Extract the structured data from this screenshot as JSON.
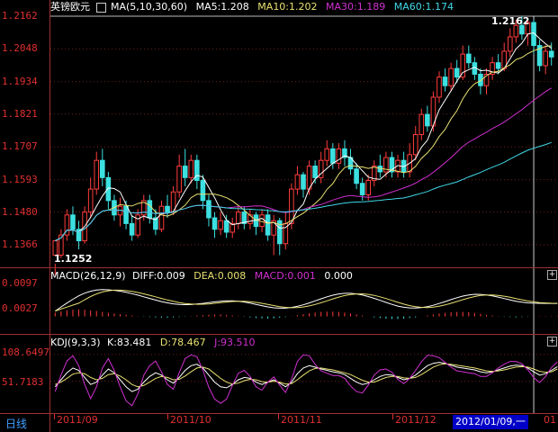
{
  "header": {
    "instrument": "英镑欧元",
    "indicator": "MA(5,10,30,60)",
    "ma5": "MA5:1.208",
    "ma10": "MA10:1.202",
    "ma30": "MA30:1.189",
    "ma60": "MA60:1.174"
  },
  "price_panel": {
    "y_ticks": [
      "1.2162",
      "1.2048",
      "1.1934",
      "1.1821",
      "1.1707",
      "1.1593",
      "1.1480",
      "1.1366"
    ],
    "high_label": "1.2162",
    "low_label": "1.1252"
  },
  "macd_panel": {
    "name": "MACD(26,12,9)",
    "diff": "DIFF:0.009",
    "dea": "DEA:0.008",
    "macd": "MACD:0.001",
    "extra": "0.000",
    "y_ticks": [
      "0.0097",
      "0.0027"
    ]
  },
  "kdj_panel": {
    "name": "KDJ(9,3,3)",
    "k": "K:83.481",
    "d": "D:78.467",
    "j": "J:93.510",
    "y_ticks": [
      "108.6497",
      "51.7183"
    ]
  },
  "footer": {
    "period": "日线",
    "dates": [
      "2011/09",
      "2011/10",
      "2011/11",
      "2011/12"
    ],
    "cursor_date": "2012/01/09,一",
    "next_date_stub": "01"
  },
  "colors": {
    "up": "#ff3c3c",
    "down": "#3ce0e0",
    "ma5": "#ffffff",
    "ma10": "#e8e070",
    "ma30": "#d030d0",
    "ma60": "#40d8e8",
    "axis": "#e03030",
    "cursor_bg": "#0000c8"
  },
  "chart_data": [
    {
      "type": "candlestick",
      "title": "英镑欧元",
      "ylim": [
        1.1252,
        1.2162
      ],
      "ohlc": [
        [
          1.133,
          1.138,
          1.13,
          1.126
        ],
        [
          1.133,
          1.14,
          1.142,
          1.132
        ],
        [
          1.14,
          1.147,
          1.149,
          1.138
        ],
        [
          1.147,
          1.142,
          1.15,
          1.14
        ],
        [
          1.142,
          1.138,
          1.145,
          1.135
        ],
        [
          1.138,
          1.148,
          1.15,
          1.137
        ],
        [
          1.148,
          1.156,
          1.16,
          1.146
        ],
        [
          1.156,
          1.166,
          1.169,
          1.154
        ],
        [
          1.166,
          1.16,
          1.17,
          1.157
        ],
        [
          1.16,
          1.152,
          1.162,
          1.149
        ],
        [
          1.152,
          1.147,
          1.154,
          1.145
        ],
        [
          1.147,
          1.15,
          1.153,
          1.143
        ],
        [
          1.15,
          1.144,
          1.152,
          1.142
        ],
        [
          1.144,
          1.14,
          1.147,
          1.138
        ],
        [
          1.14,
          1.147,
          1.149,
          1.139
        ],
        [
          1.147,
          1.152,
          1.154,
          1.145
        ],
        [
          1.152,
          1.146,
          1.154,
          1.144
        ],
        [
          1.146,
          1.142,
          1.149,
          1.14
        ],
        [
          1.142,
          1.15,
          1.152,
          1.141
        ],
        [
          1.15,
          1.148,
          1.154,
          1.146
        ],
        [
          1.148,
          1.155,
          1.157,
          1.147
        ],
        [
          1.155,
          1.164,
          1.168,
          1.153
        ],
        [
          1.164,
          1.16,
          1.17,
          1.157
        ],
        [
          1.16,
          1.166,
          1.168,
          1.158
        ],
        [
          1.166,
          1.159,
          1.168,
          1.156
        ],
        [
          1.159,
          1.152,
          1.161,
          1.149
        ],
        [
          1.152,
          1.146,
          1.154,
          1.143
        ],
        [
          1.146,
          1.142,
          1.148,
          1.139
        ],
        [
          1.142,
          1.145,
          1.148,
          1.14
        ],
        [
          1.145,
          1.141,
          1.147,
          1.139
        ],
        [
          1.141,
          1.144,
          1.146,
          1.139
        ],
        [
          1.144,
          1.148,
          1.15,
          1.142
        ],
        [
          1.148,
          1.144,
          1.15,
          1.142
        ],
        [
          1.144,
          1.147,
          1.149,
          1.142
        ],
        [
          1.147,
          1.143,
          1.148,
          1.14
        ],
        [
          1.143,
          1.147,
          1.149,
          1.141
        ],
        [
          1.147,
          1.14,
          1.149,
          1.138
        ],
        [
          1.14,
          1.145,
          1.147,
          1.133
        ],
        [
          1.145,
          1.137,
          1.146,
          1.133
        ],
        [
          1.137,
          1.144,
          1.148,
          1.135
        ],
        [
          1.144,
          1.156,
          1.158,
          1.142
        ],
        [
          1.156,
          1.161,
          1.164,
          1.154
        ],
        [
          1.161,
          1.156,
          1.162,
          1.153
        ],
        [
          1.156,
          1.164,
          1.166,
          1.154
        ],
        [
          1.164,
          1.16,
          1.166,
          1.158
        ],
        [
          1.16,
          1.166,
          1.169,
          1.158
        ],
        [
          1.166,
          1.17,
          1.173,
          1.164
        ],
        [
          1.17,
          1.165,
          1.172,
          1.163
        ],
        [
          1.165,
          1.17,
          1.172,
          1.163
        ],
        [
          1.17,
          1.167,
          1.173,
          1.164
        ],
        [
          1.167,
          1.163,
          1.17,
          1.161
        ],
        [
          1.163,
          1.158,
          1.165,
          1.156
        ],
        [
          1.158,
          1.154,
          1.16,
          1.152
        ],
        [
          1.154,
          1.159,
          1.161,
          1.152
        ],
        [
          1.159,
          1.164,
          1.166,
          1.157
        ],
        [
          1.164,
          1.162,
          1.168,
          1.16
        ],
        [
          1.162,
          1.167,
          1.169,
          1.16
        ],
        [
          1.167,
          1.162,
          1.169,
          1.16
        ],
        [
          1.162,
          1.166,
          1.168,
          1.16
        ],
        [
          1.166,
          1.162,
          1.169,
          1.16
        ],
        [
          1.162,
          1.168,
          1.172,
          1.16
        ],
        [
          1.168,
          1.175,
          1.178,
          1.166
        ],
        [
          1.175,
          1.182,
          1.184,
          1.173
        ],
        [
          1.182,
          1.178,
          1.185,
          1.176
        ],
        [
          1.178,
          1.188,
          1.19,
          1.176
        ],
        [
          1.188,
          1.195,
          1.197,
          1.186
        ],
        [
          1.195,
          1.192,
          1.198,
          1.19
        ],
        [
          1.192,
          1.198,
          1.2,
          1.19
        ],
        [
          1.198,
          1.195,
          1.201,
          1.193
        ],
        [
          1.195,
          1.203,
          1.206,
          1.194
        ],
        [
          1.203,
          1.2,
          1.206,
          1.198
        ],
        [
          1.2,
          1.196,
          1.202,
          1.194
        ],
        [
          1.196,
          1.192,
          1.198,
          1.189
        ],
        [
          1.192,
          1.196,
          1.198,
          1.189
        ],
        [
          1.196,
          1.2,
          1.202,
          1.194
        ],
        [
          1.2,
          1.198,
          1.203,
          1.196
        ],
        [
          1.198,
          1.204,
          1.207,
          1.197
        ],
        [
          1.204,
          1.209,
          1.212,
          1.202
        ],
        [
          1.209,
          1.213,
          1.215,
          1.207
        ],
        [
          1.213,
          1.21,
          1.2162,
          1.208
        ],
        [
          1.21,
          1.214,
          1.215,
          1.206
        ],
        [
          1.214,
          1.206,
          1.215,
          1.203
        ],
        [
          1.206,
          1.199,
          1.208,
          1.197
        ],
        [
          1.199,
          1.204,
          1.206,
          1.196
        ],
        [
          1.204,
          1.202,
          1.207,
          1.199
        ]
      ]
    },
    {
      "type": "bar",
      "title": "MACD(26,12,9)",
      "ylim": [
        -0.004,
        0.011
      ],
      "values": [
        0.0012,
        0.0016,
        0.0019,
        0.0021,
        0.0022,
        0.0021,
        0.0019,
        0.0017,
        0.0014,
        0.0011,
        0.0009,
        0.0007,
        0.0005,
        0.0003,
        0.0001,
        -0.0001,
        -0.0002,
        -0.0003,
        -0.0004,
        -0.0004,
        -0.0003,
        -0.0002,
        -0.0001,
        0.0001,
        0.0003,
        0.0004,
        0.0005,
        0.0006,
        0.0006,
        0.0005,
        0.0003,
        0.0001,
        -0.0001,
        -0.0003,
        -0.0005,
        -0.0006,
        -0.0007,
        -0.0006,
        -0.0004,
        -0.0002,
        0.0001,
        0.0004,
        0.0007,
        0.001,
        0.0012,
        0.0014,
        0.0015,
        0.0015,
        0.0014,
        0.0012,
        0.0009,
        0.0006,
        0.0003,
        0.0,
        -0.0003,
        -0.0005,
        -0.0007,
        -0.0008,
        -0.0008,
        -0.0007,
        -0.0005,
        -0.0003,
        0.0,
        0.0003,
        0.0006,
        0.0009,
        0.0011,
        0.0013,
        0.0014,
        0.0014,
        0.0013,
        0.0011,
        0.0008,
        0.0005,
        0.0003,
        0.0001,
        -0.0001,
        -0.0002,
        -0.0003,
        -0.0002,
        -0.0001,
        0.0,
        0.0001,
        0.0001,
        0.0001,
        0.0001
      ]
    },
    {
      "type": "line",
      "title": "KDJ(9,3,3)",
      "ylim": [
        -10,
        120
      ],
      "series": [
        {
          "name": "K",
          "values": [
            40,
            55,
            70,
            80,
            75,
            60,
            45,
            50,
            65,
            78,
            70,
            55,
            40,
            30,
            35,
            50,
            62,
            70,
            65,
            55,
            48,
            60,
            75,
            85,
            88,
            80,
            65,
            50,
            40,
            38,
            45,
            55,
            60,
            58,
            50,
            45,
            50,
            55,
            48,
            40,
            50,
            68,
            80,
            85,
            82,
            78,
            75,
            72,
            70,
            66,
            58,
            50,
            45,
            48,
            55,
            62,
            66,
            65,
            60,
            55,
            58,
            65,
            75,
            85,
            90,
            92,
            90,
            86,
            82,
            80,
            78,
            76,
            72,
            70,
            72,
            76,
            80,
            84,
            86,
            85,
            80,
            72,
            65,
            68,
            75,
            83
          ]
        },
        {
          "name": "D",
          "values": [
            45,
            50,
            58,
            67,
            70,
            68,
            60,
            55,
            58,
            66,
            68,
            63,
            55,
            45,
            40,
            43,
            50,
            58,
            62,
            60,
            55,
            56,
            63,
            72,
            80,
            82,
            78,
            68,
            58,
            50,
            46,
            48,
            53,
            56,
            55,
            51,
            50,
            52,
            50,
            46,
            47,
            55,
            65,
            74,
            79,
            80,
            78,
            76,
            73,
            70,
            66,
            60,
            54,
            50,
            50,
            55,
            60,
            62,
            62,
            59,
            58,
            60,
            66,
            74,
            82,
            87,
            89,
            88,
            86,
            84,
            82,
            80,
            77,
            74,
            73,
            74,
            76,
            79,
            82,
            83,
            82,
            78,
            73,
            71,
            72,
            78
          ]
        },
        {
          "name": "J",
          "values": [
            30,
            65,
            95,
            106,
            85,
            45,
            15,
            40,
            80,
            100,
            75,
            40,
            10,
            0,
            25,
            65,
            85,
            95,
            72,
            45,
            35,
            70,
            100,
            108,
            104,
            76,
            39,
            14,
            5,
            14,
            43,
            69,
            75,
            62,
            40,
            33,
            50,
            61,
            44,
            28,
            56,
            94,
            108,
            106,
            88,
            74,
            69,
            64,
            64,
            58,
            42,
            30,
            27,
            44,
            65,
            76,
            78,
            71,
            56,
            47,
            58,
            75,
            93,
            107,
            106,
            102,
            92,
            82,
            74,
            72,
            70,
            68,
            62,
            62,
            70,
            80,
            88,
            94,
            94,
            89,
            76,
            60,
            49,
            62,
            81,
            93
          ]
        }
      ]
    }
  ]
}
